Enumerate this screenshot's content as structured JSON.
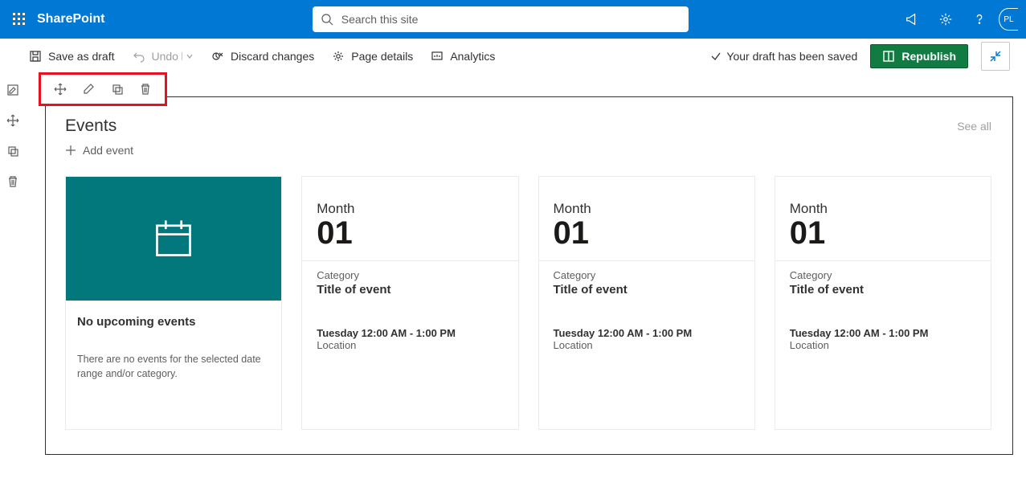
{
  "suite": {
    "brand": "SharePoint",
    "search_placeholder": "Search this site",
    "avatar_initials": "PL"
  },
  "command_bar": {
    "save_draft": "Save as draft",
    "undo": "Undo",
    "discard": "Discard changes",
    "page_details": "Page details",
    "analytics": "Analytics",
    "saved_status": "Your draft has been saved",
    "republish": "Republish"
  },
  "webpart": {
    "title": "Events",
    "see_all": "See all",
    "add_event": "Add event",
    "empty": {
      "heading": "No upcoming events",
      "body": "There are no events for the selected date range and/or category."
    },
    "events": [
      {
        "month": "Month",
        "day": "01",
        "category": "Category",
        "title": "Title of event",
        "time": "Tuesday 12:00 AM - 1:00 PM",
        "location": "Location"
      },
      {
        "month": "Month",
        "day": "01",
        "category": "Category",
        "title": "Title of event",
        "time": "Tuesday 12:00 AM - 1:00 PM",
        "location": "Location"
      },
      {
        "month": "Month",
        "day": "01",
        "category": "Category",
        "title": "Title of event",
        "time": "Tuesday 12:00 AM - 1:00 PM",
        "location": "Location"
      }
    ]
  }
}
